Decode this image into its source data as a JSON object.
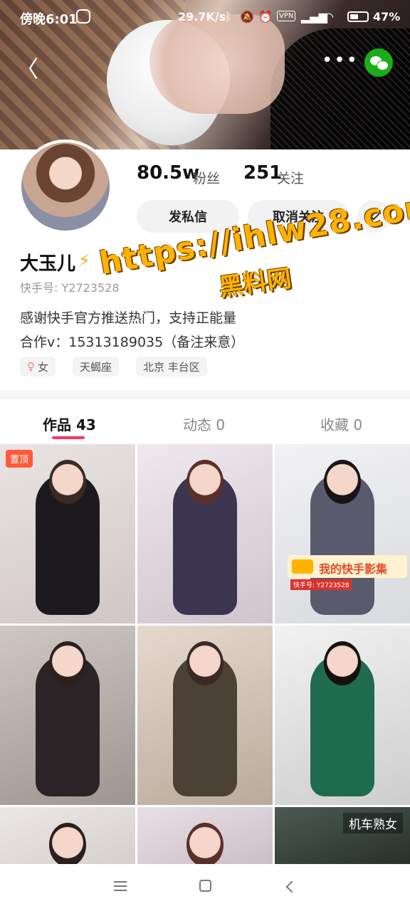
{
  "status_bar": {
    "time": "傍晚6:01",
    "network_speed": "29.7K/s",
    "vpn": "VPN",
    "battery": "47%"
  },
  "profile": {
    "followers_count": "80.5w",
    "followers_label": "粉丝",
    "following_count": "251",
    "following_label": "关注",
    "message_button": "发私信",
    "unfollow_button": "取消关注",
    "name": "大玉儿",
    "kuaishou_id": "快手号: Y2723528",
    "bio_line1": "感谢快手官方推送热门，支持正能量",
    "bio_line2": "合作v：15313189035（备注来意）",
    "tags": [
      "女",
      "天蝎座",
      "北京 丰台区"
    ]
  },
  "watermark": {
    "url": "https://ihlw28.com",
    "site": "黑料网"
  },
  "tabs": [
    {
      "label": "作品 43",
      "active": true
    },
    {
      "label": "动态 0",
      "active": false
    },
    {
      "label": "收藏 0",
      "active": false
    }
  ],
  "grid": {
    "pinned_label": "置顶",
    "promo_text": "我的快手影集",
    "promo_id": "快手号: Y2723528",
    "corner_label": "机车熟女"
  },
  "colors": {
    "accent": "#fe3666",
    "pin": "#fe5a3a",
    "wechat": "#1aad19",
    "watermark": "#ffb300"
  }
}
